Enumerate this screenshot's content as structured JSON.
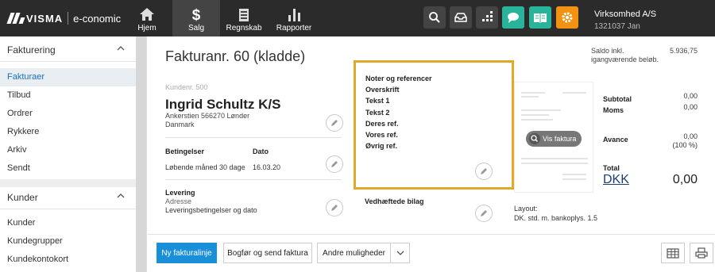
{
  "app": {
    "brand": "VISMA",
    "product": "e-conomic"
  },
  "nav": [
    {
      "label": "Hjem",
      "icon": "home-icon"
    },
    {
      "label": "Salg",
      "icon": "dollar-icon"
    },
    {
      "label": "Regnskab",
      "icon": "ledger-icon"
    },
    {
      "label": "Rapporter",
      "icon": "bar-chart-icon"
    }
  ],
  "toolbar_icons": [
    "search-icon",
    "inbox-icon",
    "apps-icon",
    "chat-icon",
    "book-icon",
    "gear-icon"
  ],
  "company": {
    "name": "Virksomhed A/S",
    "sub": "1321037 Jan"
  },
  "sidebar": {
    "section1": {
      "title": "Fakturering",
      "items": [
        "Fakturaer",
        "Tilbud",
        "Ordrer",
        "Rykkere",
        "Arkiv",
        "Sendt"
      ]
    },
    "section2": {
      "title": "Kunder",
      "items": [
        "Kunder",
        "Kundegrupper",
        "Kundekontokort"
      ]
    }
  },
  "invoice": {
    "title": "Fakturanr. 60 (kladde)",
    "saldo_label_1": "Saldo inkl.",
    "saldo_label_2": "igangværende beløb.",
    "saldo_value": "5.936,75",
    "kundenr": "Kundenr. 500",
    "customer_name": "Ingrid Schultz K/S",
    "address_1": "Ankerstien 566270 Lønder",
    "address_2": "Danmark",
    "betingelser_label": "Betingelser",
    "betingelser_value": "Løbende måned 30 dage",
    "dato_label": "Dato",
    "dato_value": "16.03.20",
    "levering_label": "Levering",
    "levering_line1": "Adresse",
    "levering_line2": "Leveringsbetingelser og  dato",
    "notes": [
      "Noter og referencer",
      "Overskrift",
      "Tekst 1",
      "Tekst 2",
      "Deres ref.",
      "Vores ref.",
      "Øvrig ref."
    ],
    "vedhaeftede": "Vedhæftede bilag",
    "vis_faktura": "Vis faktura",
    "layout_label": "Layout:",
    "layout_value": "DK. std. m. bankoplys. 1.5",
    "subtotal_label": "Subtotal",
    "subtotal_value": "0,00",
    "moms_label": "Moms",
    "moms_value": "0,00",
    "avance_label": "Avance",
    "avance_value": "0,00",
    "avance_pct": "(100 %)",
    "total_label": "Total",
    "currency": "DKK",
    "total_value": "0,00"
  },
  "footer": {
    "new_line": "Ny fakturalinje",
    "book_send": "Bogfør og send faktura",
    "more": "Andre muligheder"
  },
  "colors": {
    "topbar": "#2b2b2b",
    "accent_blue": "#1a8fd9",
    "green": "#28b39a",
    "orange": "#f29112",
    "highlight": "#e2a828"
  }
}
